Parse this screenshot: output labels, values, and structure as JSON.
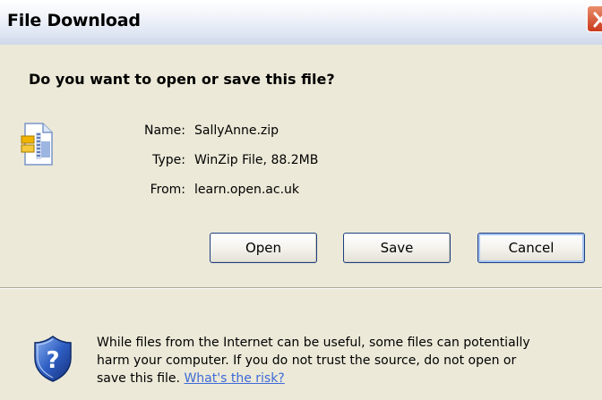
{
  "window": {
    "title": "File Download",
    "close_icon": "close-icon"
  },
  "dialog": {
    "question": "Do you want to open or save this file?",
    "file_icon": "zip-file-icon",
    "fields": [
      {
        "label": "Name:",
        "value": "SallyAnne.zip"
      },
      {
        "label": "Type:",
        "value": "WinZip File, 88.2MB"
      },
      {
        "label": "From:",
        "value": "learn.open.ac.uk"
      }
    ],
    "buttons": {
      "open": "Open",
      "save": "Save",
      "cancel": "Cancel"
    },
    "warning": {
      "icon": "shield-question-icon",
      "line1": "While files from the Internet can be useful, some files can potentially",
      "line2": "harm your computer. If you do not trust the source, do not open or",
      "line3_prefix": "save this file. ",
      "link": "What's the risk?"
    }
  },
  "colors": {
    "background": "#ece9d8",
    "link": "#3d6ad6",
    "close_button": "#c9381b"
  }
}
